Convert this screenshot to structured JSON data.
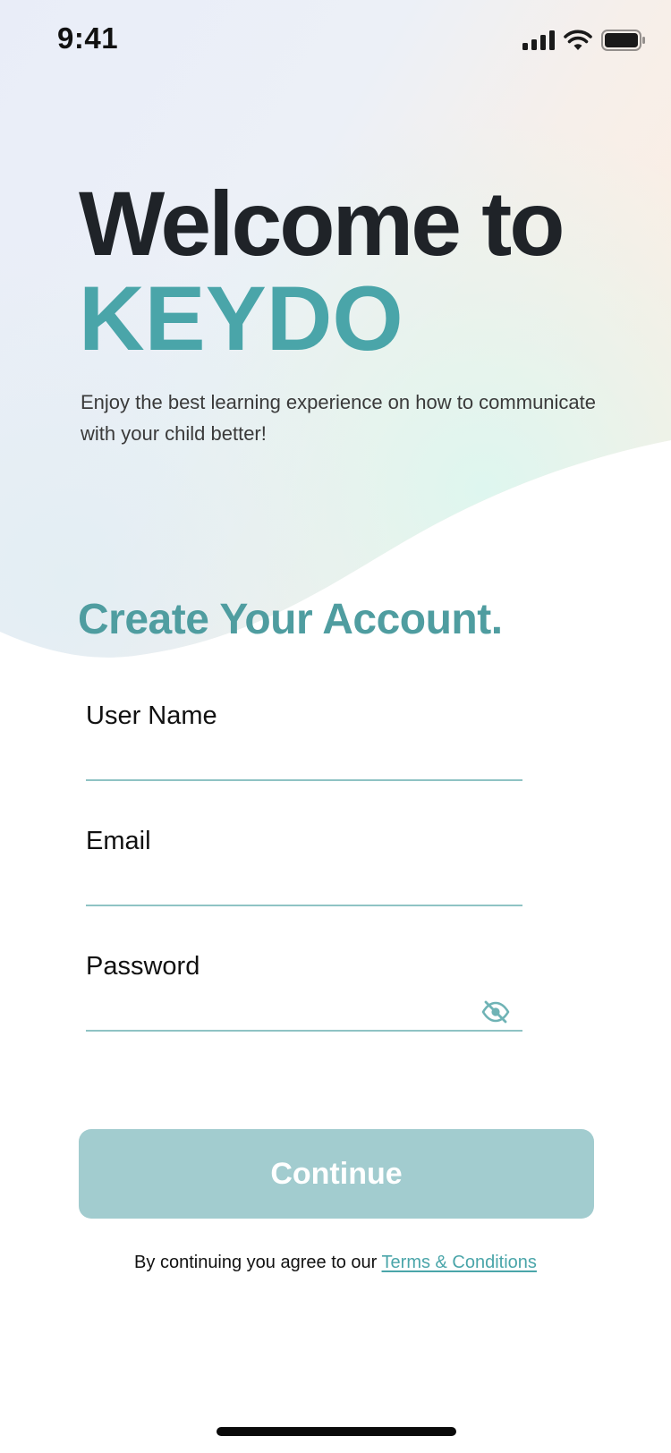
{
  "status_bar": {
    "time": "9:41",
    "icons": [
      "cellular-signal-icon",
      "wifi-icon",
      "battery-icon"
    ]
  },
  "hero": {
    "welcome": "Welcome to",
    "brand": "KEYDO",
    "subtitle": "Enjoy the best learning experience on how to communicate with your child better!"
  },
  "form": {
    "title": "Create Your Account.",
    "fields": [
      {
        "label": "User Name",
        "value": "",
        "placeholder": ""
      },
      {
        "label": "Email",
        "value": "",
        "placeholder": ""
      },
      {
        "label": "Password",
        "value": "",
        "placeholder": "",
        "icon": "eye-slash-icon"
      }
    ],
    "continue_label": "Continue"
  },
  "footer": {
    "agree_text": "By continuing you agree to our ",
    "terms_link": "Terms & Conditions"
  },
  "colors": {
    "brand_teal": "#4aa5a9",
    "title_teal": "#4f9da0",
    "button_disabled": "#a2cccf",
    "underline": "#8fc3c4",
    "heading_dark": "#1f2328"
  }
}
